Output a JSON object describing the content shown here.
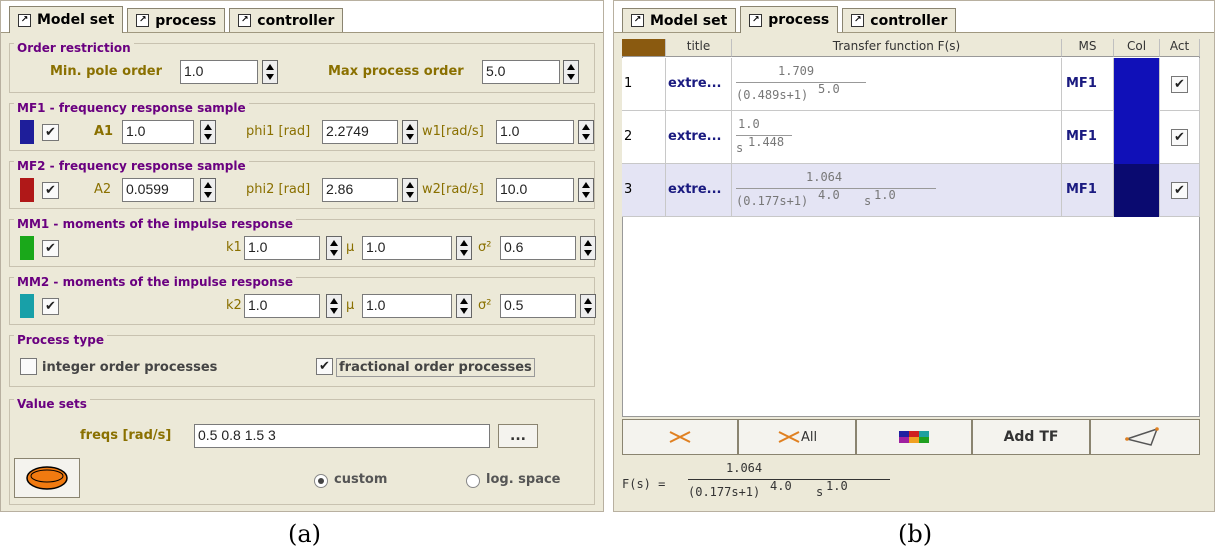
{
  "left": {
    "tabs": [
      "Model set",
      "process",
      "controller"
    ],
    "order": {
      "title": "Order restriction",
      "min_label": "Min. pole order",
      "min_value": "1.0",
      "max_label": "Max process order",
      "max_value": "5.0"
    },
    "mf1": {
      "title": "MF1 - frequency response sample",
      "color": "#1e1e9a",
      "checked": "✔",
      "a_label": "A1",
      "a_value": "1.0",
      "phi_label": "phi1 [rad]",
      "phi_value": "2.2749",
      "w_label": "w1[rad/s]",
      "w_value": "1.0"
    },
    "mf2": {
      "title": "MF2 - frequency response sample",
      "color": "#b01818",
      "checked": "✔",
      "a_label": "A2",
      "a_value": "0.0599",
      "phi_label": "phi2 [rad]",
      "phi_value": "2.86",
      "w_label": "w2[rad/s]",
      "w_value": "10.0"
    },
    "mm1": {
      "title": "MM1 - moments of the impulse response",
      "color": "#1aa81a",
      "checked": "✔",
      "k_label": "k1",
      "k_value": "1.0",
      "mu_label": "µ",
      "mu_value": "1.0",
      "s_label": "σ²",
      "s_value": "0.6"
    },
    "mm2": {
      "title": "MM2 - moments of the impulse response",
      "color": "#18a0a8",
      "checked": "✔",
      "k_label": "k2",
      "k_value": "1.0",
      "mu_label": "µ",
      "mu_value": "1.0",
      "s_label": "σ²",
      "s_value": "0.5"
    },
    "ptype": {
      "title": "Process type",
      "integer_label": "integer order processes",
      "integer_checked": "",
      "fractional_label": "fractional order processes",
      "fractional_checked": "✔"
    },
    "values": {
      "title": "Value sets",
      "freqs_label": "freqs [rad/s]",
      "freqs_value": "0.5 0.8 1.5 3",
      "browse_label": "...",
      "custom_label": "custom",
      "log_label": "log. space"
    },
    "caption": "(a)"
  },
  "right": {
    "tabs": [
      "Model set",
      "process",
      "controller"
    ],
    "columns": [
      "title",
      "Transfer function F(s)",
      "MS",
      "Col",
      "Act"
    ],
    "rows": [
      {
        "n": "1",
        "title": "extre...",
        "num": "1.709",
        "den1": "(0.489s+1)",
        "exp1": "5.0",
        "den2": "",
        "exp2": "",
        "ms": "MF1",
        "col": "#1010b8",
        "act": "✔"
      },
      {
        "n": "2",
        "title": "extre...",
        "num": "1.0",
        "den1": "s",
        "exp1": "1.448",
        "den2": "",
        "exp2": "",
        "ms": "MF1",
        "col": "#1010b8",
        "act": "✔"
      },
      {
        "n": "3",
        "title": "extre...",
        "num": "1.064",
        "den1": "(0.177s+1)",
        "exp1": "4.0",
        "den2": "s",
        "exp2": "1.0",
        "ms": "MF1",
        "col": "#0a0a70",
        "act": "✔"
      }
    ],
    "toolbar": {
      "delete_all_label": "All",
      "add_tf_label": "Add TF"
    },
    "formula": {
      "lhs": "F(s) =",
      "num": "1.064",
      "den1": "(0.177s+1)",
      "exp1": "4.0",
      "den2": "s",
      "exp2": "1.0"
    },
    "caption": "(b)"
  }
}
